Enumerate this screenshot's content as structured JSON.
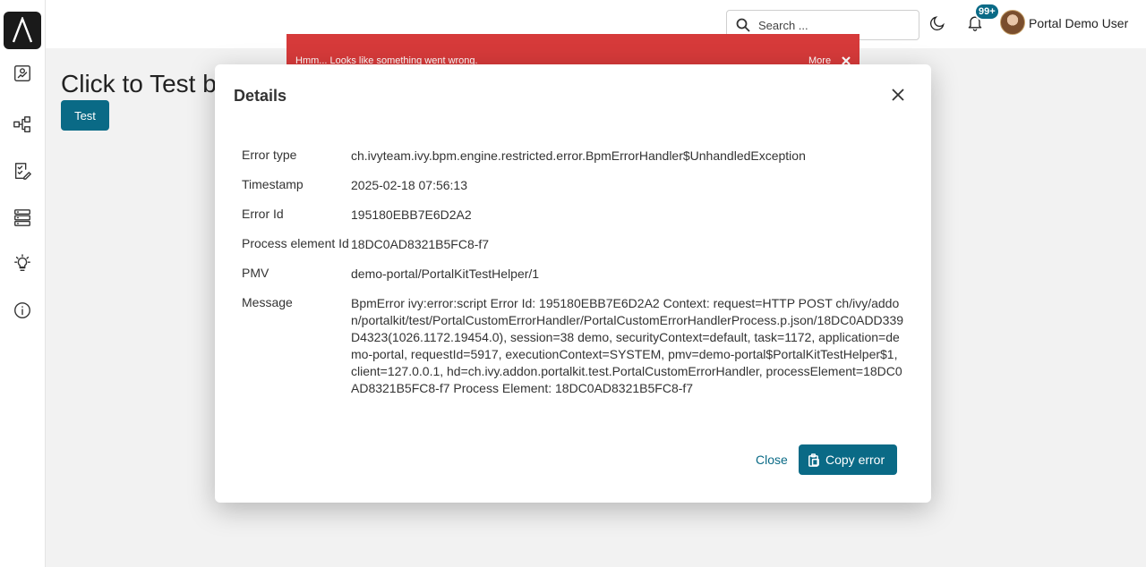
{
  "topbar": {
    "search_placeholder": "Search ...",
    "notification_count": "99+",
    "username": "Portal Demo User"
  },
  "sidebar": {
    "items": [
      {
        "icon": "dashboard-icon"
      },
      {
        "icon": "process-icon"
      },
      {
        "icon": "task-icon"
      },
      {
        "icon": "case-list-icon"
      },
      {
        "icon": "lightbulb-icon"
      },
      {
        "icon": "info-icon"
      }
    ]
  },
  "page": {
    "heading": "Click to Test b",
    "test_button": "Test"
  },
  "toast": {
    "message": "Hmm... Looks like something went wrong.",
    "more_label": "More"
  },
  "dialog": {
    "title": "Details",
    "rows": [
      {
        "label": "Error type",
        "value": "ch.ivyteam.ivy.bpm.engine.restricted.error.BpmErrorHandler$UnhandledException"
      },
      {
        "label": "Timestamp",
        "value": "2025-02-18 07:56:13"
      },
      {
        "label": "Error Id",
        "value": "195180EBB7E6D2A2"
      },
      {
        "label": "Process element Id",
        "value": "18DC0AD8321B5FC8-f7"
      },
      {
        "label": "PMV",
        "value": "demo-portal/PortalKitTestHelper/1"
      },
      {
        "label": "Message",
        "value": "BpmError ivy:error:script Error Id: 195180EBB7E6D2A2 Context: request=HTTP POST ch/ivy/addon/portalkit/test/PortalCustomErrorHandler/PortalCustomErrorHandlerProcess.p.json/18DC0ADD339D4323(1026.1172.19454.0), session=38 demo, securityContext=default, task=1172, application=demo-portal, requestId=5917, executionContext=SYSTEM, pmv=demo-portal$PortalKitTestHelper$1, client=127.0.0.1, hd=ch.ivy.addon.portalkit.test.PortalCustomErrorHandler, processElement=18DC0AD8321B5FC8-f7 Process Element: 18DC0AD8321B5FC8-f7"
      }
    ],
    "close_label": "Close",
    "copy_label": "Copy error"
  },
  "colors": {
    "accent": "#0a6a86",
    "toast_error": "#d63a3a"
  }
}
